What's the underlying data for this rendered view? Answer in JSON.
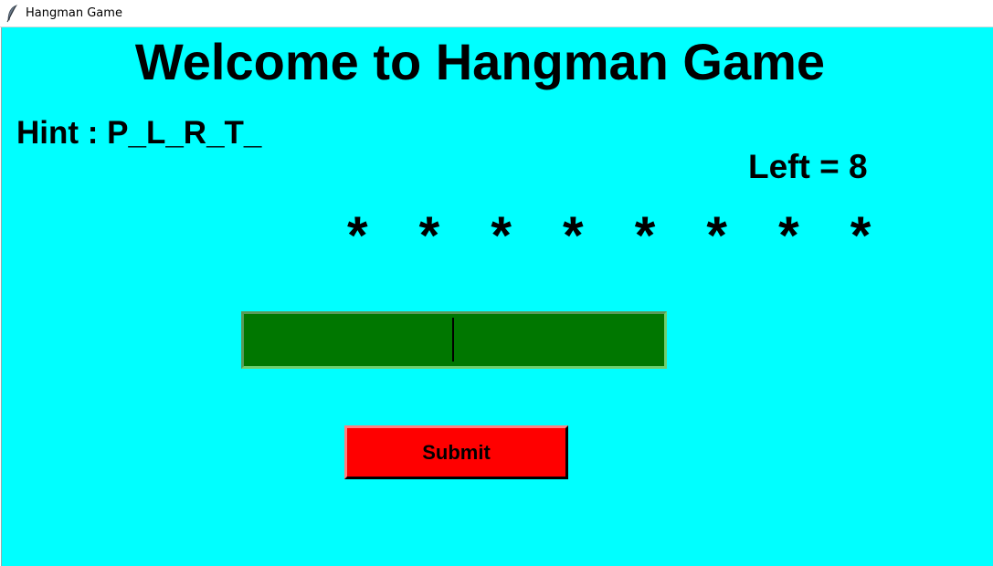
{
  "window": {
    "title": "Hangman Game",
    "icon": "feather-icon"
  },
  "game": {
    "heading": "Welcome to Hangman Game",
    "hint": "Hint : P_L_R_T_",
    "left": "Left = 8",
    "masked_word": "* * * * * * * *",
    "guess_value": "",
    "submit_label": "Submit"
  },
  "colors": {
    "background": "#00ffff",
    "entry": "#007700",
    "submit": "#ff0000"
  }
}
